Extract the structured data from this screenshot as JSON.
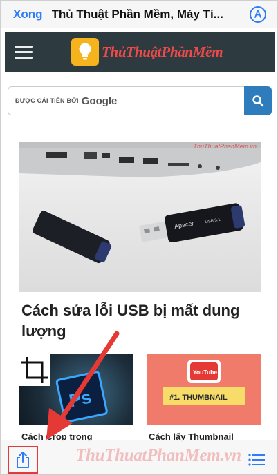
{
  "topbar": {
    "done_label": "Xong",
    "title": "Thủ Thuật Phần Mềm, Máy Tí..."
  },
  "site": {
    "logo_part1": "ThủThuật",
    "logo_part2": "PhầnMềm"
  },
  "search": {
    "label": "ĐƯỢC CẢI TIẾN BỞI",
    "brand": "Google"
  },
  "hero": {
    "watermark": "ThuThuatPhanMem.vn",
    "usb_brand": "Apacer",
    "usb_model": "USB 3.1"
  },
  "article": {
    "title": "Cách sửa lỗi USB bị mất dung lượng"
  },
  "cards": [
    {
      "title": "Cách Crop trong",
      "image_text": "Ps"
    },
    {
      "title": "Cách lấy Thumbnail",
      "image_badge": "YouTube",
      "image_text": "#1. THUMBNAIL"
    }
  ],
  "bottombar": {
    "watermark": "ThuThuatPhanMem.vn"
  },
  "colors": {
    "accent_blue": "#2f7cf6",
    "header_bg": "#2d3a40",
    "search_button": "#2f7cbd",
    "highlight_red": "#e23a3a"
  },
  "icons": [
    "markup-icon",
    "hamburger-icon",
    "lightbulb-logo-icon",
    "search-icon",
    "share-icon",
    "list-icon"
  ]
}
